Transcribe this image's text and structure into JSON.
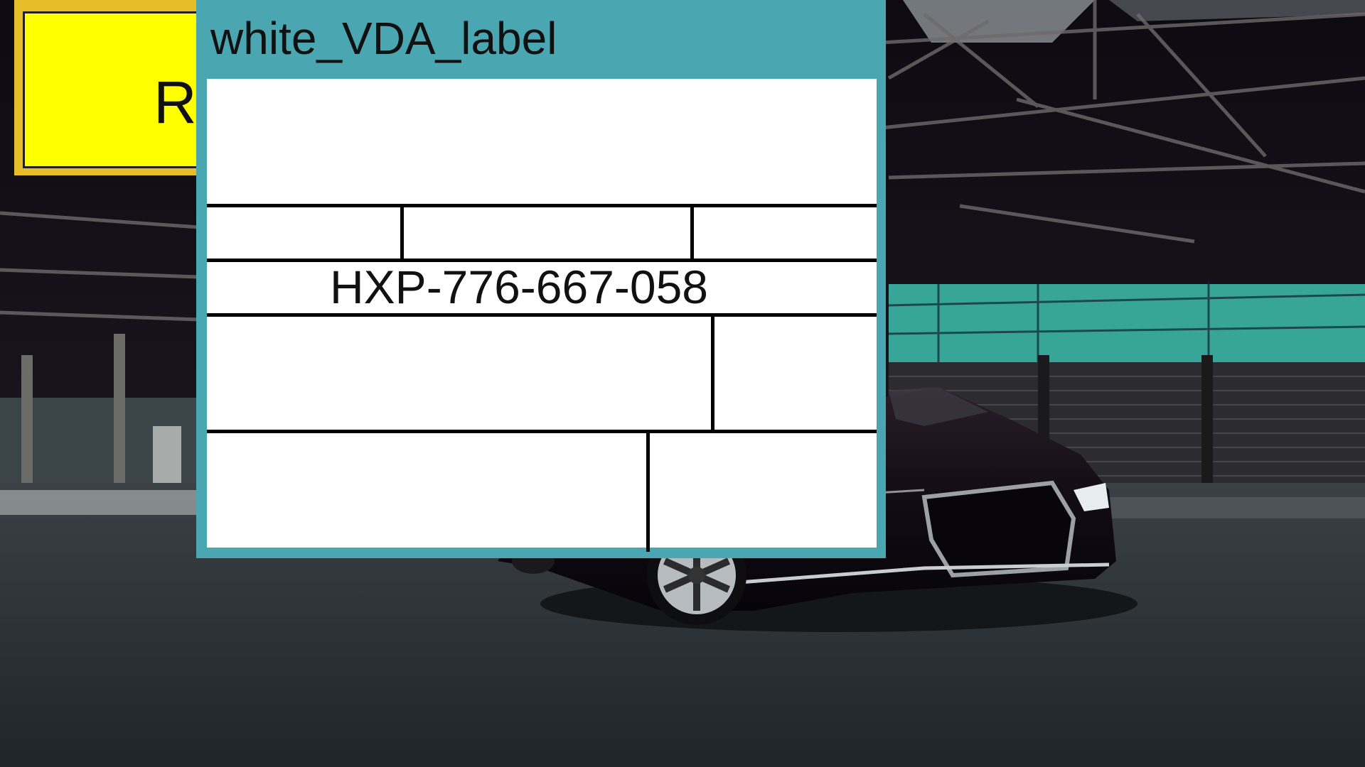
{
  "yellow_label": {
    "visible_text": "R"
  },
  "vda_label": {
    "title": "white_VDA_label",
    "code": "HXP-776-667-058"
  },
  "colors": {
    "teal_frame": "#4aa7b2",
    "yellow_frame": "#e6be2a",
    "yellow_fill": "#ffff00",
    "label_fill": "#ffffff"
  }
}
